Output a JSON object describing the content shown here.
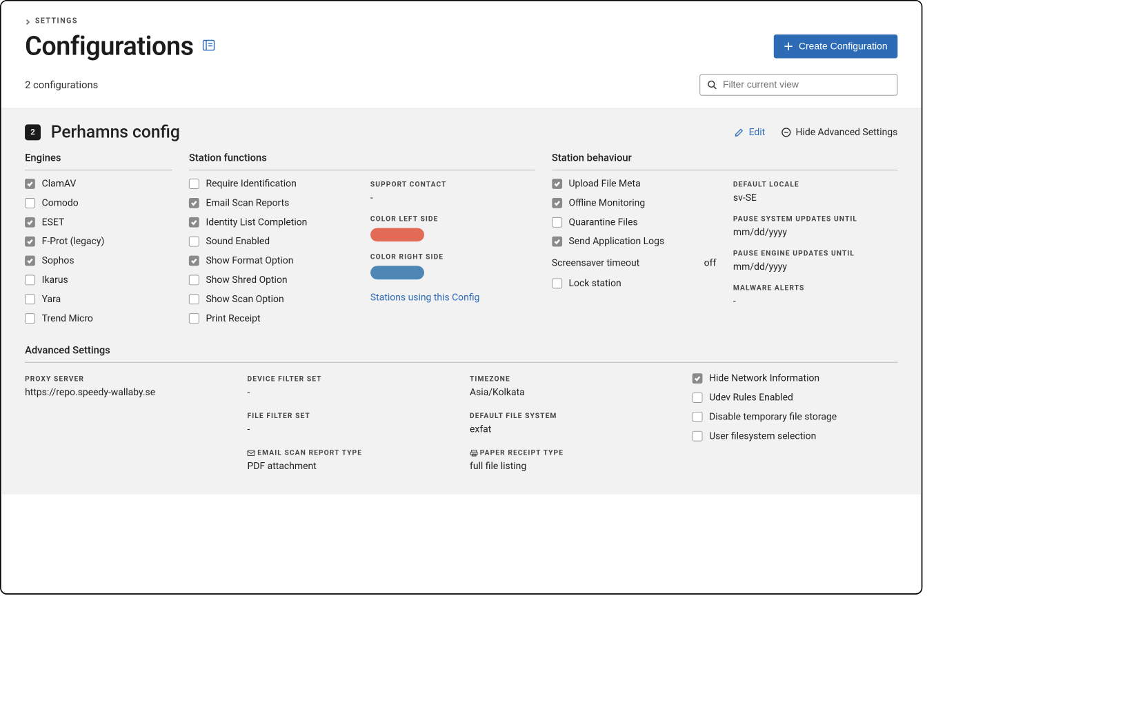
{
  "breadcrumb": {
    "settings": "SETTINGS"
  },
  "page": {
    "title": "Configurations",
    "count_text": "2 configurations",
    "create_button": "Create Configuration",
    "filter_placeholder": "Filter current view"
  },
  "config": {
    "badge": "2",
    "name": "Perhamns config",
    "edit_label": "Edit",
    "hide_advanced_label": "Hide Advanced Settings"
  },
  "sections": {
    "engines_title": "Engines",
    "station_functions_title": "Station functions",
    "station_behaviour_title": "Station behaviour",
    "advanced_title": "Advanced Settings"
  },
  "engines": [
    {
      "label": "ClamAV",
      "checked": true
    },
    {
      "label": "Comodo",
      "checked": false
    },
    {
      "label": "ESET",
      "checked": true
    },
    {
      "label": "F-Prot (legacy)",
      "checked": true
    },
    {
      "label": "Sophos",
      "checked": true
    },
    {
      "label": "Ikarus",
      "checked": false
    },
    {
      "label": "Yara",
      "checked": false
    },
    {
      "label": "Trend Micro",
      "checked": false
    }
  ],
  "station_functions": [
    {
      "label": "Require Identification",
      "checked": false
    },
    {
      "label": "Email Scan Reports",
      "checked": true
    },
    {
      "label": "Identity List Completion",
      "checked": true
    },
    {
      "label": "Sound Enabled",
      "checked": false
    },
    {
      "label": "Show Format Option",
      "checked": true
    },
    {
      "label": "Show Shred Option",
      "checked": false
    },
    {
      "label": "Show Scan Option",
      "checked": false
    },
    {
      "label": "Print Receipt",
      "checked": false
    }
  ],
  "support_contact": {
    "label": "Support Contact",
    "value": "-"
  },
  "color_left": {
    "label": "Color Left Side",
    "value": "#e36a56"
  },
  "color_right": {
    "label": "Color Right Side",
    "value": "#4e86b5"
  },
  "stations_link": "Stations using this Config",
  "station_behaviour": [
    {
      "label": "Upload File Meta",
      "checked": true
    },
    {
      "label": "Offline Monitoring",
      "checked": true
    },
    {
      "label": "Quarantine Files",
      "checked": false
    },
    {
      "label": "Send Application Logs",
      "checked": true
    }
  ],
  "screensaver": {
    "label": "Screensaver timeout",
    "value": "off"
  },
  "lock_station": {
    "label": "Lock station",
    "checked": false
  },
  "behaviour_right": {
    "default_locale": {
      "label": "Default Locale",
      "value": "sv-SE"
    },
    "pause_system": {
      "label": "Pause System Updates Until",
      "value": "mm/dd/yyyy"
    },
    "pause_engine": {
      "label": "Pause Engine Updates Until",
      "value": "mm/dd/yyyy"
    },
    "malware_alerts": {
      "label": "Malware Alerts",
      "value": "-"
    }
  },
  "advanced": {
    "proxy": {
      "label": "Proxy Server",
      "value": "https://repo.speedy-wallaby.se"
    },
    "device_filter": {
      "label": "Device Filter Set",
      "value": "-"
    },
    "file_filter": {
      "label": "File Filter Set",
      "value": "-"
    },
    "email_report_type": {
      "label": "Email Scan Report Type",
      "value": "PDF attachment"
    },
    "timezone": {
      "label": "Timezone",
      "value": "Asia/Kolkata"
    },
    "default_fs": {
      "label": "Default File System",
      "value": "exfat"
    },
    "paper_receipt": {
      "label": "Paper Receipt Type",
      "value": "full file listing"
    },
    "checks": [
      {
        "label": "Hide Network Information",
        "checked": true
      },
      {
        "label": "Udev Rules Enabled",
        "checked": false
      },
      {
        "label": "Disable temporary file storage",
        "checked": false
      },
      {
        "label": "User filesystem selection",
        "checked": false
      }
    ]
  }
}
